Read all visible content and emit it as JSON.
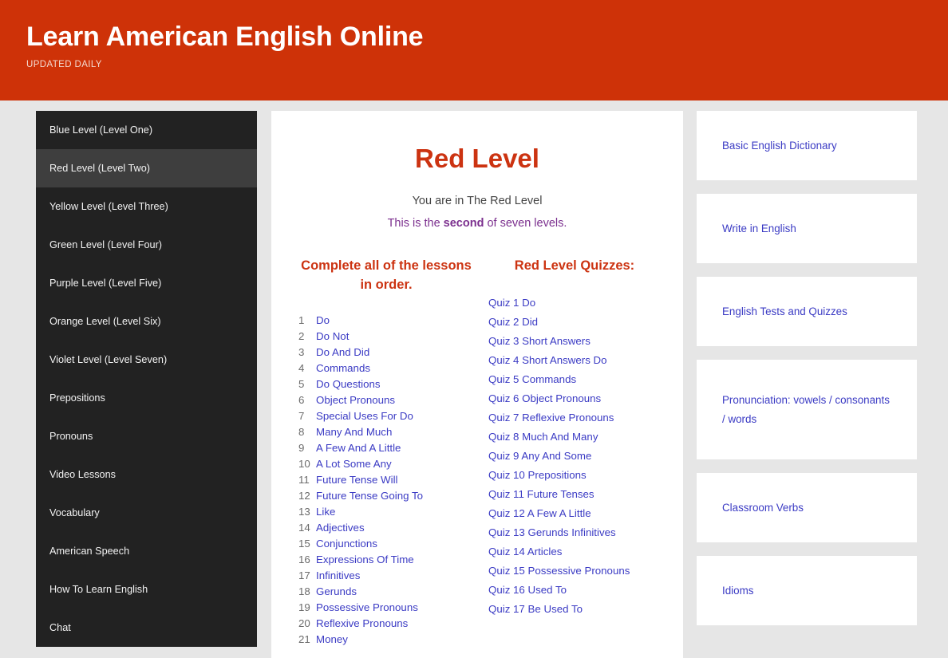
{
  "header": {
    "title": "Learn American English Online",
    "tagline": "UPDATED DAILY"
  },
  "sidebar": {
    "items": [
      {
        "label": "Blue Level (Level One)",
        "active": false
      },
      {
        "label": "Red Level (Level Two)",
        "active": true
      },
      {
        "label": "Yellow Level (Level Three)",
        "active": false
      },
      {
        "label": "Green Level (Level Four)",
        "active": false
      },
      {
        "label": "Purple Level (Level Five)",
        "active": false
      },
      {
        "label": "Orange Level (Level Six)",
        "active": false
      },
      {
        "label": "Violet Level (Level Seven)",
        "active": false
      },
      {
        "label": "Prepositions",
        "active": false
      },
      {
        "label": "Pronouns",
        "active": false
      },
      {
        "label": "Video Lessons",
        "active": false
      },
      {
        "label": "Vocabulary",
        "active": false
      },
      {
        "label": "American Speech",
        "active": false
      },
      {
        "label": "How To Learn English",
        "active": false
      },
      {
        "label": "Chat",
        "active": false
      }
    ]
  },
  "main": {
    "title": "Red Level",
    "subtitle": "You are in The Red Level",
    "note_prefix": "This is the ",
    "note_emphasis": "second",
    "note_suffix": " of seven levels.",
    "lessons_heading": "Complete all of the lessons in order.",
    "quizzes_heading": "Red Level Quizzes:",
    "lessons": [
      {
        "num": "1",
        "label": "Do"
      },
      {
        "num": "2",
        "label": "Do Not"
      },
      {
        "num": "3",
        "label": "Do And Did"
      },
      {
        "num": "4",
        "label": "Commands"
      },
      {
        "num": "5",
        "label": "Do Questions"
      },
      {
        "num": "6",
        "label": "Object Pronouns"
      },
      {
        "num": "7",
        "label": "Special Uses For Do"
      },
      {
        "num": "8",
        "label": "Many And Much"
      },
      {
        "num": "9",
        "label": "A Few And A Little"
      },
      {
        "num": "10",
        "label": "A Lot Some Any"
      },
      {
        "num": "11",
        "label": "Future Tense Will"
      },
      {
        "num": "12",
        "label": "Future Tense Going To"
      },
      {
        "num": "13",
        "label": "Like"
      },
      {
        "num": "14",
        "label": "Adjectives"
      },
      {
        "num": "15",
        "label": "Conjunctions"
      },
      {
        "num": "16",
        "label": "Expressions Of Time"
      },
      {
        "num": "17",
        "label": "Infinitives"
      },
      {
        "num": "18",
        "label": "Gerunds"
      },
      {
        "num": "19",
        "label": "Possessive Pronouns"
      },
      {
        "num": "20",
        "label": "Reflexive Pronouns"
      },
      {
        "num": "21",
        "label": "Money"
      }
    ],
    "quizzes": [
      {
        "label": "Quiz 1 Do"
      },
      {
        "label": "Quiz 2 Did"
      },
      {
        "label": "Quiz 3 Short Answers"
      },
      {
        "label": "Quiz 4 Short Answers Do"
      },
      {
        "label": "Quiz 5 Commands"
      },
      {
        "label": "Quiz 6 Object Pronouns"
      },
      {
        "label": "Quiz 7 Reflexive Pronouns"
      },
      {
        "label": "Quiz 8 Much And Many"
      },
      {
        "label": "Quiz 9 Any And Some"
      },
      {
        "label": "Quiz 10 Prepositions"
      },
      {
        "label": "Quiz 11 Future Tenses"
      },
      {
        "label": "Quiz 12 A Few A Little"
      },
      {
        "label": "Quiz 13 Gerunds Infinitives"
      },
      {
        "label": "Quiz 14 Articles"
      },
      {
        "label": "Quiz 15 Possessive Pronouns"
      },
      {
        "label": "Quiz 16 Used To"
      },
      {
        "label": "Quiz 17 Be Used To"
      }
    ]
  },
  "right_rail": {
    "cards": [
      {
        "label": "Basic English Dictionary",
        "tall": false
      },
      {
        "label": "Write in English",
        "tall": false
      },
      {
        "label": "English Tests and Quizzes",
        "tall": false
      },
      {
        "label": "Pronunciation: vowels / consonants / words",
        "tall": true
      },
      {
        "label": "Classroom Verbs",
        "tall": false
      },
      {
        "label": "Idioms",
        "tall": false
      }
    ]
  },
  "colors": {
    "brand_red": "#ce3208",
    "title_red": "#cc3311",
    "link_blue": "#3b3bc4",
    "note_purple": "#7b2f8e",
    "nav_bg": "#222222",
    "nav_active_bg": "#3e3e3e",
    "page_bg": "#e6e6e6"
  }
}
